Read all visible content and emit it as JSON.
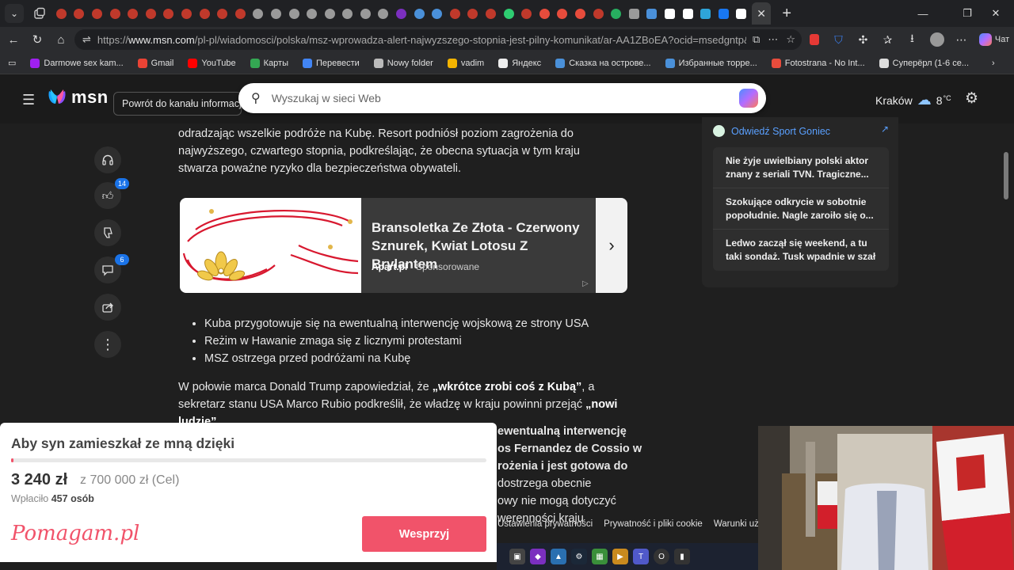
{
  "browser": {
    "tab_favicon_colors": [
      "#c0392b",
      "#c0392b",
      "#c0392b",
      "#c0392b",
      "#c0392b",
      "#c0392b",
      "#c0392b",
      "#c0392b",
      "#c0392b",
      "#c0392b",
      "#c0392b",
      "#9a9a9a",
      "#9a9a9a",
      "#9a9a9a",
      "#9a9a9a",
      "#9a9a9a",
      "#9a9a9a",
      "#9a9a9a",
      "#9a9a9a",
      "#7b2fbf",
      "#4a90d9",
      "#4a90d9",
      "#c0392b",
      "#c0392b",
      "#c0392b",
      "#2ecc71",
      "#c0392b",
      "#e74c3c",
      "#e74c3c",
      "#e74c3c",
      "#c0392b",
      "#27ae60",
      "#9a9a9a",
      "#4a90d9",
      "#ffffff",
      "#ffffff",
      "#2ea5d9",
      "#1877f2",
      "#ffffff"
    ],
    "active_tab_close": "✕",
    "new_tab": "+",
    "url_prefix": "https://",
    "url_host": "www.msn.com",
    "url_path": "/pl-pl/wiadomosci/polska/msz-wprowadza-alert-najwyzszego-stopnia-jest-pilny-komunikat/ar-AA1ZBoEA?ocid=msedgntp&pc=...",
    "chat_label": "Чат",
    "bookmarks": [
      {
        "label": "Darmowe sex kam...",
        "color": "#a020f0"
      },
      {
        "label": "Gmail",
        "color": "#ea4335"
      },
      {
        "label": "YouTube",
        "color": "#ff0000"
      },
      {
        "label": "Карты",
        "color": "#34a853"
      },
      {
        "label": "Перевести",
        "color": "#4285f4"
      },
      {
        "label": "Nowy folder",
        "color": "#bbbbbb"
      },
      {
        "label": "vadim",
        "color": "#f4b400"
      },
      {
        "label": "Яндекс",
        "color": "#eeeeee"
      },
      {
        "label": "Сказка на острове...",
        "color": "#4a90d9"
      },
      {
        "label": "Избранные торре...",
        "color": "#4a90d9"
      },
      {
        "label": "Fotostrana - No Int...",
        "color": "#e74c3c"
      },
      {
        "label": "Суперёрл (1-6 се...",
        "color": "#dddddd"
      }
    ]
  },
  "msn": {
    "logo_text": "msn",
    "back_button": "Powrót do kanału informacji",
    "search_placeholder": "Wyszukaj w sieci Web",
    "weather_city": "Kraków",
    "weather_temp": "8",
    "weather_unit": "°C"
  },
  "article": {
    "intro": "odradzając wszelkie podróże na Kubę. Resort podniósł poziom zagrożenia do najwyższego, czwartego stopnia, podkreślając, że obecna sytuacja w tym kraju stwarza poważne ryzyko dla bezpieczeństwa obywateli.",
    "likes_count": "14",
    "comments_count": "6",
    "ad": {
      "title": "Bransoletka Ze Złota - Czerwony Sznurek, Kwiat Lotosu Z Brylantem",
      "advertiser": "Apart.pl",
      "sponsored": "Sponsorowane"
    },
    "bullets": [
      "Kuba przygotowuje się na ewentualną interwencję wojskową ze strony USA",
      "Reżim w Hawanie zmaga się z licznymi protestami",
      "MSZ ostrzega przed podróżami na Kubę"
    ],
    "para2_a": "W połowie marca Donald Trump zapowiedział, że ",
    "para2_b": "„wkrótce zrobi coś z Kubą”",
    "para2_c": ", a sekretarz stanu USA Marco Rubio podkreślił, że władzę w kraju powinni przejąć ",
    "para2_d": "„nowi ludzie”",
    "para2_e": ".",
    "para3_lines": [
      "ewentualną interwencję",
      "os Fernandez de Cossio w",
      "rożenia i jest gotowa do",
      "dostrzega obecnie",
      "owy nie mogą dotyczyć",
      "werenności kraju"
    ]
  },
  "sidebar_right": {
    "header": "Odwiedź Sport Goniec",
    "items": [
      "Nie żyje uwielbiany polski aktor znany z seriali TVN. Tragiczne...",
      "Szokujące odkrycie w sobotnie popołudnie. Nagle zaroiło się o...",
      "Ledwo zaczął się weekend, a tu taki sondaż. Tusk wpadnie w szał"
    ]
  },
  "footer": {
    "links": [
      "Ustawienia prywatności",
      "Prywatność i pliki cookie",
      "Warunki uży"
    ]
  },
  "popup": {
    "title": "Aby syn zamieszkał ze mną dzięki",
    "amount": "3 240 zł",
    "goal": "z 700 000 zł (Cel)",
    "donors_label": "Wpłaciło",
    "donors_count": "457 osób",
    "logo": "Pomagam.pl",
    "button": "Wesprzyj",
    "progress_fraction": 0.005
  }
}
